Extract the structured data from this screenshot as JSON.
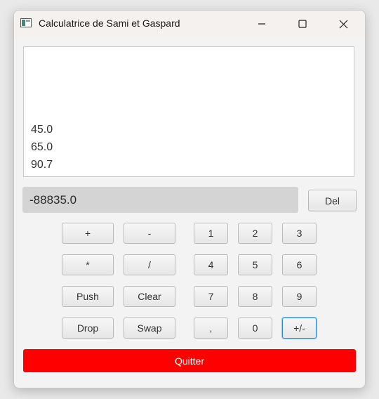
{
  "window": {
    "title": "Calculatrice de Sami et Gaspard",
    "controls": {
      "minimize_icon": "minimize-icon",
      "maximize_icon": "maximize-icon",
      "close_icon": "close-icon"
    }
  },
  "history": {
    "items": [
      "45.0",
      "65.0",
      "90.7"
    ]
  },
  "display": {
    "value": "-88835.0"
  },
  "buttons": {
    "del": "Del",
    "ops": {
      "plus": "+",
      "minus": "-",
      "times": "*",
      "divide": "/",
      "push": "Push",
      "clear": "Clear",
      "drop": "Drop",
      "swap": "Swap"
    },
    "digits": {
      "d1": "1",
      "d2": "2",
      "d3": "3",
      "d4": "4",
      "d5": "5",
      "d6": "6",
      "d7": "7",
      "d8": "8",
      "d9": "9",
      "comma": ",",
      "d0": "0",
      "sign": "+/-"
    },
    "quit": "Quitter"
  },
  "colors": {
    "quit_bg": "#ff0000",
    "focus_border": "#2a8fd6",
    "display_bg": "#d4d4d4"
  }
}
